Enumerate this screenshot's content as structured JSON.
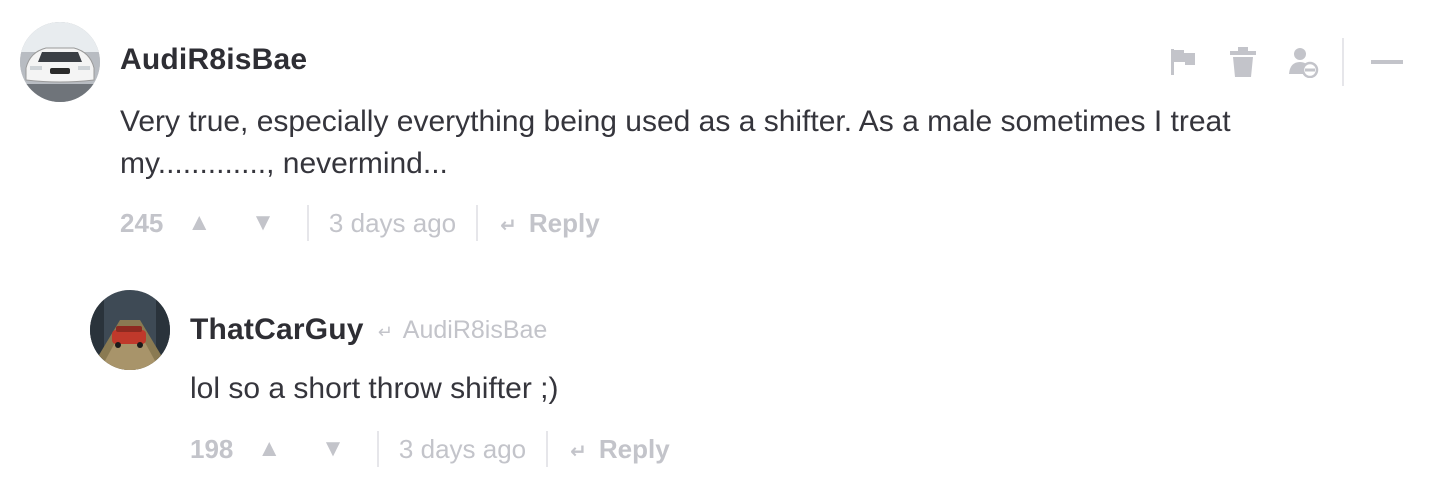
{
  "comments": [
    {
      "author": "AudiR8isBae",
      "text_line1": "Very true, especially everything being used as a shifter. As a male sometimes I treat",
      "text_line2": "my............., nevermind...",
      "votes": "245",
      "upvote_glyph": "▲",
      "downvote_glyph": "▼",
      "time": "3 days ago",
      "reply_arrow": "↵",
      "reply_label": "Reply"
    },
    {
      "author": "ThatCarGuy",
      "reply_to_arrow": "↵",
      "reply_to": "AudiR8isBae",
      "text": "lol so a short throw shifter ;)",
      "votes": "198",
      "upvote_glyph": "▲",
      "downvote_glyph": "▼",
      "time": "3 days ago",
      "reply_arrow": "↵",
      "reply_label": "Reply"
    }
  ],
  "actions": {
    "icons": [
      "flag-icon",
      "trash-icon",
      "block-user-icon",
      "collapse-icon"
    ],
    "color": "#c3c4ca"
  },
  "colors": {
    "text": "#35353c",
    "muted": "#c3c4ca",
    "divider": "#e6e6ea"
  }
}
